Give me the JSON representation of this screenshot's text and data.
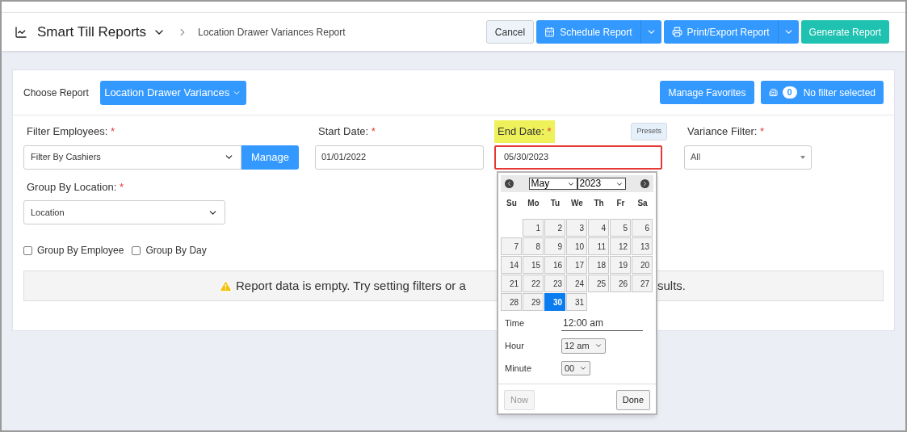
{
  "header": {
    "title": "Smart Till Reports",
    "breadcrumb": "Location Drawer Variances Report",
    "buttons": [
      {
        "label": "Cancel",
        "kind": "plain",
        "has_caret": false
      },
      {
        "label": "Schedule Report",
        "kind": "calendar",
        "has_caret": true
      },
      {
        "label": "Print/Export Report",
        "kind": "print",
        "has_caret": true
      },
      {
        "label": "Generate Report",
        "kind": "generate",
        "has_caret": false
      }
    ]
  },
  "report_bar": {
    "label": "Choose Report",
    "report": "Location Drawer Variances",
    "favorites_button": "Manage Favorites",
    "filter_count": "0",
    "filter_label": "No filter selected"
  },
  "filters": {
    "employees": {
      "label": "Filter Employees:",
      "required": "*",
      "value": "Filter By Cashiers",
      "button": "Manage"
    },
    "start_date": {
      "label": "Start Date:",
      "required": "*",
      "value": "01/01/2022"
    },
    "end_date": {
      "label": "End Date:",
      "required": "*",
      "value": "05/30/2023",
      "presets": "Presets",
      "highlighted": true
    },
    "variance": {
      "label": "Variance Filter:",
      "required": "*",
      "value": "All"
    },
    "location": {
      "label": "Group By Location:",
      "required": "*",
      "value": "Location"
    }
  },
  "checkboxes": [
    {
      "label": "Group By Employee",
      "checked": false
    },
    {
      "label": "Group By Day",
      "checked": false
    }
  ],
  "message_parts": [
    "Report data is empty. Try setting filters or a",
    "sults."
  ],
  "datepicker": {
    "month": "May",
    "year": "2023",
    "weekdays": [
      "Su",
      "Mo",
      "Tu",
      "We",
      "Th",
      "Fr",
      "Sa"
    ],
    "days": [
      {
        "label": "1",
        "selected": false
      },
      {
        "label": "2",
        "selected": false
      },
      {
        "label": "3",
        "selected": false
      },
      {
        "label": "4",
        "selected": false
      },
      {
        "label": "5",
        "selected": false
      },
      {
        "label": "6",
        "selected": false
      },
      {
        "label": "7",
        "selected": false
      },
      {
        "label": "8",
        "selected": false
      },
      {
        "label": "9",
        "selected": false
      },
      {
        "label": "10",
        "selected": false
      },
      {
        "label": "11",
        "selected": false
      },
      {
        "label": "12",
        "selected": false
      },
      {
        "label": "13",
        "selected": false
      },
      {
        "label": "14",
        "selected": false
      },
      {
        "label": "15",
        "selected": false
      },
      {
        "label": "16",
        "selected": false
      },
      {
        "label": "17",
        "selected": false
      },
      {
        "label": "18",
        "selected": false
      },
      {
        "label": "19",
        "selected": false
      },
      {
        "label": "20",
        "selected": false
      },
      {
        "label": "21",
        "selected": false
      },
      {
        "label": "22",
        "selected": false
      },
      {
        "label": "23",
        "selected": false
      },
      {
        "label": "24",
        "selected": false
      },
      {
        "label": "25",
        "selected": false
      },
      {
        "label": "26",
        "selected": false
      },
      {
        "label": "27",
        "selected": false
      },
      {
        "label": "28",
        "selected": false
      },
      {
        "label": "29",
        "selected": false
      },
      {
        "label": "30",
        "selected": true
      },
      {
        "label": "31",
        "selected": false
      }
    ],
    "time_label": "Time",
    "time_value": "12:00 am",
    "hour_label": "Hour",
    "hour_value": "12 am",
    "minute_label": "Minute",
    "minute_value": "00",
    "now_button": {
      "label": "Now",
      "disabled": true
    },
    "done_button": {
      "label": "Done",
      "disabled": false
    }
  }
}
